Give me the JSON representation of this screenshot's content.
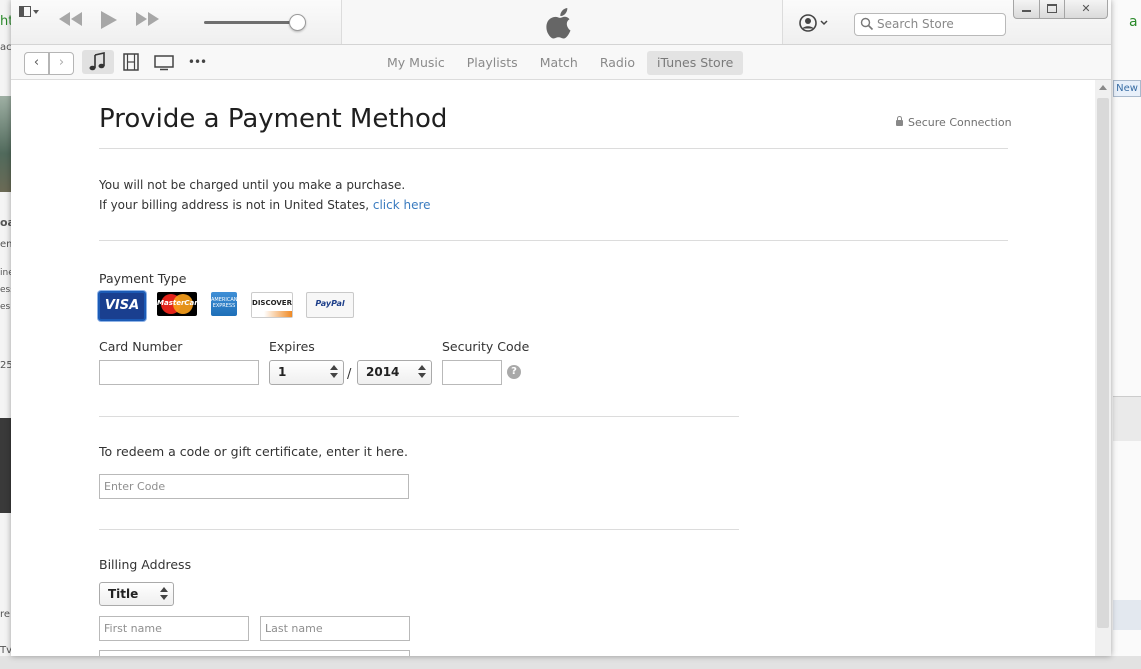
{
  "background": {
    "left_fragments": [
      "ht",
      "ac",
      "oa",
      "em",
      "ine",
      "ess",
      "es",
      "25",
      "re",
      "Tv"
    ],
    "right_badge": "New"
  },
  "titlebar": {
    "search_placeholder": "Search Store"
  },
  "navbar": {
    "back_label": "‹",
    "forward_label": "›",
    "more_label": "•••",
    "tabs": [
      {
        "label": "My Music",
        "active": false
      },
      {
        "label": "Playlists",
        "active": false
      },
      {
        "label": "Match",
        "active": false
      },
      {
        "label": "Radio",
        "active": false
      },
      {
        "label": "iTunes Store",
        "active": true
      }
    ]
  },
  "page": {
    "title": "Provide a Payment Method",
    "secure_label": "Secure Connection",
    "notice_line1": "You will not be charged until you make a purchase.",
    "notice_line2_prefix": "If your billing address is not in United States, ",
    "notice_link": "click here",
    "payment_type_label": "Payment Type",
    "cards": {
      "visa": "VISA",
      "mastercard": "MasterCard",
      "amex": "AMERICAN EXPRESS",
      "discover": "DISCOVER",
      "paypal": "PayPal"
    },
    "selected_card": "visa",
    "card_number_label": "Card Number",
    "card_number_value": "",
    "expires_label": "Expires",
    "expires_month": "1",
    "expires_year": "2014",
    "date_separator": "/",
    "security_code_label": "Security Code",
    "help_glyph": "?",
    "redeem_text": "To redeem a code or gift certificate, enter it here.",
    "code_placeholder": "Enter Code",
    "billing_label": "Billing Address",
    "title_select": "Title",
    "first_name_placeholder": "First name",
    "last_name_placeholder": "Last name"
  },
  "colors": {
    "link": "#3a7bbf",
    "visa_selected_border": "#1c5bb6",
    "tab_active_bg": "#e3e3e3"
  }
}
